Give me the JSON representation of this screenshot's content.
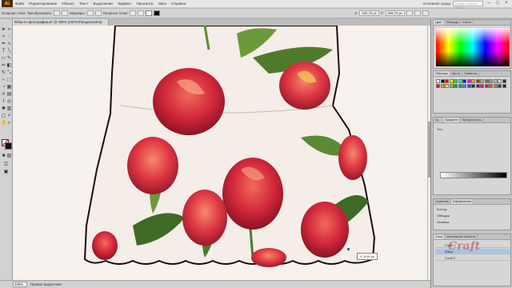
{
  "app": {
    "logo": "Ai"
  },
  "menu": [
    "Файл",
    "Редактирование",
    "Объект",
    "Текст",
    "Выделение",
    "Эффект",
    "Просмотр",
    "Окно",
    "Справка"
  ],
  "menu_right": {
    "workspace": "Основная среда",
    "search_placeholder": "Поиск в Adobe Stock"
  },
  "control_bar": {
    "object_label": "Опорная точка",
    "convert_label": "Преобразовать:",
    "handles_label": "Маркеры:",
    "anchors_label": "Опорные точки:",
    "x_label": "X:",
    "x_value": "520,75 px",
    "y_label": "Y:",
    "y_value": "608,79 px"
  },
  "document_tab": {
    "title": "Юбка по фотографии.ai* @ 400% (CMYK/Предпросмотр GPU)"
  },
  "canvas": {
    "cursor_readout": "У: 8,04 px",
    "skirt_fill": "#f4ede8",
    "outline_color": "#1e0a0a"
  },
  "status_bar": {
    "zoom": "400%",
    "tool_name": "Прямое выделение"
  },
  "panels": {
    "color_tabs": [
      "Цвет",
      "Образцы",
      "Кисти"
    ],
    "swatch_tabs": [
      "Образцы",
      "Кисти",
      "Символы"
    ],
    "gradient_tabs": [
      "Гр...",
      "Градиент",
      "Прозрачность"
    ],
    "gradient_type_label": "Тип:",
    "appearance_tabs": [
      "Свойства",
      "Оформление"
    ],
    "appearance_rows": [
      "Контур",
      "Обводка",
      "Заливка"
    ],
    "layers_tabs": [
      "Слои",
      "Монтажные области"
    ],
    "layers": [
      "Слой 1",
      "Юбка",
      "Слой 2"
    ]
  },
  "colors": {
    "menubar": "#e6e6e6",
    "panel": "#d6d6d6",
    "accent_selection": "#a9c4e6"
  },
  "swatches": [
    "#ffffff",
    "#000000",
    "#ff0000",
    "#ffff00",
    "#00ff00",
    "#00ffff",
    "#0000ff",
    "#ff00ff",
    "#ffa200",
    "#8b4513",
    "#c9a37b",
    "#777777",
    "#999999",
    "#bbbbbb",
    "#dddddd",
    "#333333",
    "#e60012",
    "#f39800",
    "#fff100",
    "#8fc31f",
    "#009944",
    "#009e96",
    "#00a0e9",
    "#0068b7",
    "#1d2088",
    "#920783",
    "#e4007f",
    "#e5004f",
    "#ea5504",
    "#b28247",
    "#4f3b2c",
    "#222222"
  ]
}
